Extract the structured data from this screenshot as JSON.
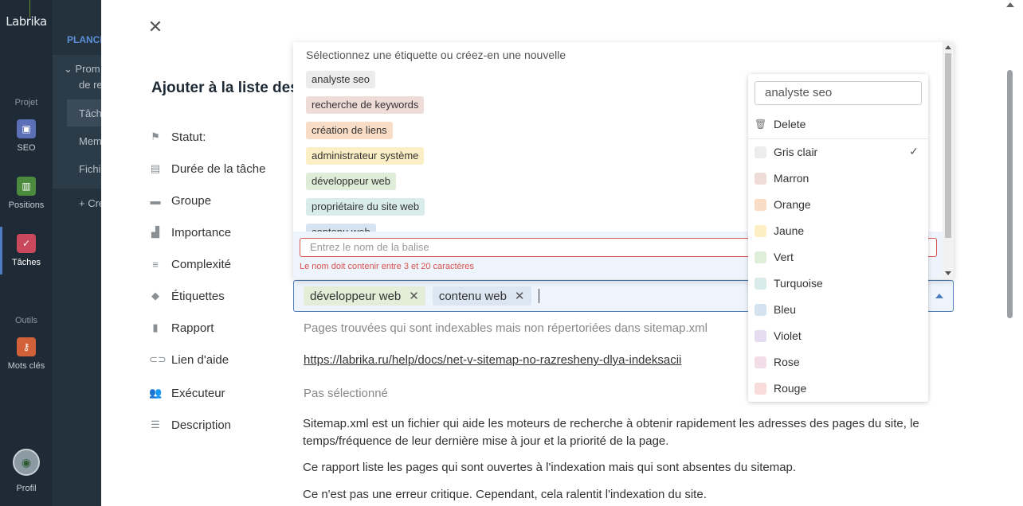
{
  "rail": {
    "logo": "Labrika",
    "section_project": "Projet",
    "section_tools": "Outils",
    "items": [
      {
        "label": "SEO",
        "color": "#5b6fb7"
      },
      {
        "label": "Positions",
        "color": "#4c8a3d"
      },
      {
        "label": "Tâches",
        "color": "#c9485b"
      },
      {
        "label": "Mots clés",
        "color": "#d2613a"
      }
    ],
    "profile": "Profil"
  },
  "col2": {
    "title": "PLANCH",
    "items": [
      "Prom",
      "de re",
      "Tâch",
      "Mem",
      "Fichi",
      "+ Cre"
    ]
  },
  "modal": {
    "title": "Ajouter à la liste des",
    "fields": [
      {
        "label": "Statut:",
        "icon": "flag-icon"
      },
      {
        "label": "Durée de la tâche",
        "icon": "calendar-icon"
      },
      {
        "label": "Groupe",
        "icon": "folder-icon"
      },
      {
        "label": "Importance",
        "icon": "bars-icon"
      },
      {
        "label": "Complexité",
        "icon": "list-icon"
      },
      {
        "label": "Étiquettes",
        "icon": "tag-icon"
      },
      {
        "label": "Rapport",
        "icon": "document-icon"
      },
      {
        "label": "Lien d'aide",
        "icon": "link-icon"
      },
      {
        "label": "Exécuteur",
        "icon": "users-icon"
      },
      {
        "label": "Description",
        "icon": "lines-icon"
      }
    ],
    "report_value": "Pages trouvées qui sont indexables mais non répertoriées dans sitemap.xml",
    "help_link": "https://labrika.ru/help/docs/net-v-sitemap-no-razresheny-dlya-indeksacii",
    "executor_value": "Pas sélectionné",
    "description": [
      "Sitemap.xml est un fichier qui aide les moteurs de recherche à obtenir rapidement les adresses des pages du site, le temps/fréquence de leur dernière mise à jour et la priorité de la page.",
      "Ce rapport liste les pages qui sont ouvertes à l'indexation mais qui sont absentes du sitemap.",
      "Ce n'est pas une erreur critique. Cependant, cela ralentit l'indexation du site."
    ]
  },
  "tag_input": {
    "chips": [
      {
        "label": "développeur web",
        "color": "#e2eed8"
      },
      {
        "label": "contenu web",
        "color": "#dbe6f2"
      }
    ]
  },
  "dropdown": {
    "header": "Sélectionnez une étiquette ou créez-en une nouvelle",
    "tags": [
      {
        "label": "analyste seo",
        "color": "#ececec"
      },
      {
        "label": "recherche de keywords",
        "color": "#efdcd8"
      },
      {
        "label": "création de liens",
        "color": "#f8dcc6"
      },
      {
        "label": "administrateur système",
        "color": "#fcefc6"
      },
      {
        "label": "développeur web",
        "color": "#dfecd7"
      },
      {
        "label": "propriétaire du site web",
        "color": "#d8ecea"
      },
      {
        "label": "contenu web",
        "color": "#d6e4f1"
      }
    ],
    "new_placeholder": "Entrez le nom de la balise",
    "error": "Le nom doit contenir entre 3 et 20 caractères"
  },
  "color_popup": {
    "input_value": "analyste seo",
    "delete_label": "Delete",
    "colors": [
      {
        "label": "Gris clair",
        "hex": "#ededed",
        "selected": true
      },
      {
        "label": "Marron",
        "hex": "#efdbd8",
        "selected": false
      },
      {
        "label": "Orange",
        "hex": "#fadbc4",
        "selected": false
      },
      {
        "label": "Jaune",
        "hex": "#fcefc4",
        "selected": false
      },
      {
        "label": "Vert",
        "hex": "#dfeed8",
        "selected": false
      },
      {
        "label": "Turquoise",
        "hex": "#d9ece9",
        "selected": false
      },
      {
        "label": "Bleu",
        "hex": "#d5e3f1",
        "selected": false
      },
      {
        "label": "Violet",
        "hex": "#e6dcef",
        "selected": false
      },
      {
        "label": "Rose",
        "hex": "#f3dde6",
        "selected": false
      },
      {
        "label": "Rouge",
        "hex": "#f8dcdc",
        "selected": false
      }
    ]
  }
}
